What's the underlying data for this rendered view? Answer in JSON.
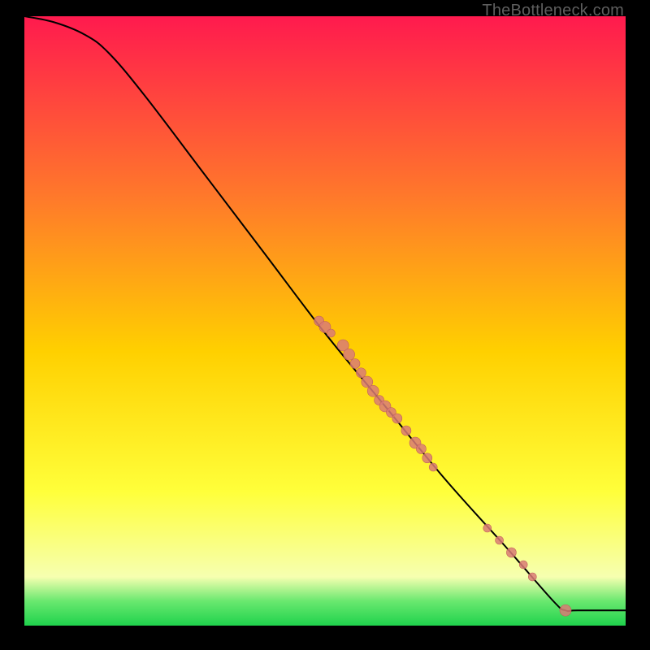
{
  "watermark": "TheBottleneck.com",
  "colors": {
    "bg": "#000000",
    "grad_top": "#ff1a4e",
    "grad_mid1": "#ff7a2a",
    "grad_mid2": "#ffd000",
    "grad_mid3": "#ffff3a",
    "grad_bottom_light": "#f6ffb0",
    "grad_green1": "#69e86f",
    "grad_green2": "#1fd24c",
    "curve": "#000000",
    "point_fill": "#d97b75",
    "point_stroke": "#c06058"
  },
  "chart_data": {
    "type": "line",
    "title": "",
    "xlabel": "",
    "ylabel": "",
    "xlim": [
      0,
      100
    ],
    "ylim": [
      0,
      100
    ],
    "curve": [
      {
        "x": 0,
        "y": 100
      },
      {
        "x": 5,
        "y": 99
      },
      {
        "x": 10,
        "y": 97
      },
      {
        "x": 14,
        "y": 94
      },
      {
        "x": 20,
        "y": 87
      },
      {
        "x": 30,
        "y": 74
      },
      {
        "x": 40,
        "y": 61
      },
      {
        "x": 50,
        "y": 48
      },
      {
        "x": 60,
        "y": 36
      },
      {
        "x": 70,
        "y": 24
      },
      {
        "x": 80,
        "y": 13
      },
      {
        "x": 88,
        "y": 4
      },
      {
        "x": 90,
        "y": 2.5
      },
      {
        "x": 92,
        "y": 2.5
      },
      {
        "x": 100,
        "y": 2.5
      }
    ],
    "points": [
      {
        "x": 49,
        "y": 50,
        "r": 6
      },
      {
        "x": 50,
        "y": 49,
        "r": 7
      },
      {
        "x": 51,
        "y": 48,
        "r": 5
      },
      {
        "x": 53,
        "y": 46,
        "r": 7
      },
      {
        "x": 54,
        "y": 44.5,
        "r": 7
      },
      {
        "x": 55,
        "y": 43,
        "r": 6
      },
      {
        "x": 56,
        "y": 41.5,
        "r": 6
      },
      {
        "x": 57,
        "y": 40,
        "r": 7
      },
      {
        "x": 58,
        "y": 38.5,
        "r": 7
      },
      {
        "x": 59,
        "y": 37,
        "r": 6
      },
      {
        "x": 60,
        "y": 36,
        "r": 7
      },
      {
        "x": 61,
        "y": 35,
        "r": 6
      },
      {
        "x": 62,
        "y": 34,
        "r": 6
      },
      {
        "x": 63.5,
        "y": 32,
        "r": 6
      },
      {
        "x": 65,
        "y": 30,
        "r": 7
      },
      {
        "x": 66,
        "y": 29,
        "r": 6
      },
      {
        "x": 67,
        "y": 27.5,
        "r": 6
      },
      {
        "x": 68,
        "y": 26,
        "r": 5
      },
      {
        "x": 77,
        "y": 16,
        "r": 5
      },
      {
        "x": 79,
        "y": 14,
        "r": 5
      },
      {
        "x": 81,
        "y": 12,
        "r": 6
      },
      {
        "x": 83,
        "y": 10,
        "r": 5
      },
      {
        "x": 84.5,
        "y": 8,
        "r": 5
      },
      {
        "x": 90,
        "y": 2.5,
        "r": 7
      }
    ]
  }
}
